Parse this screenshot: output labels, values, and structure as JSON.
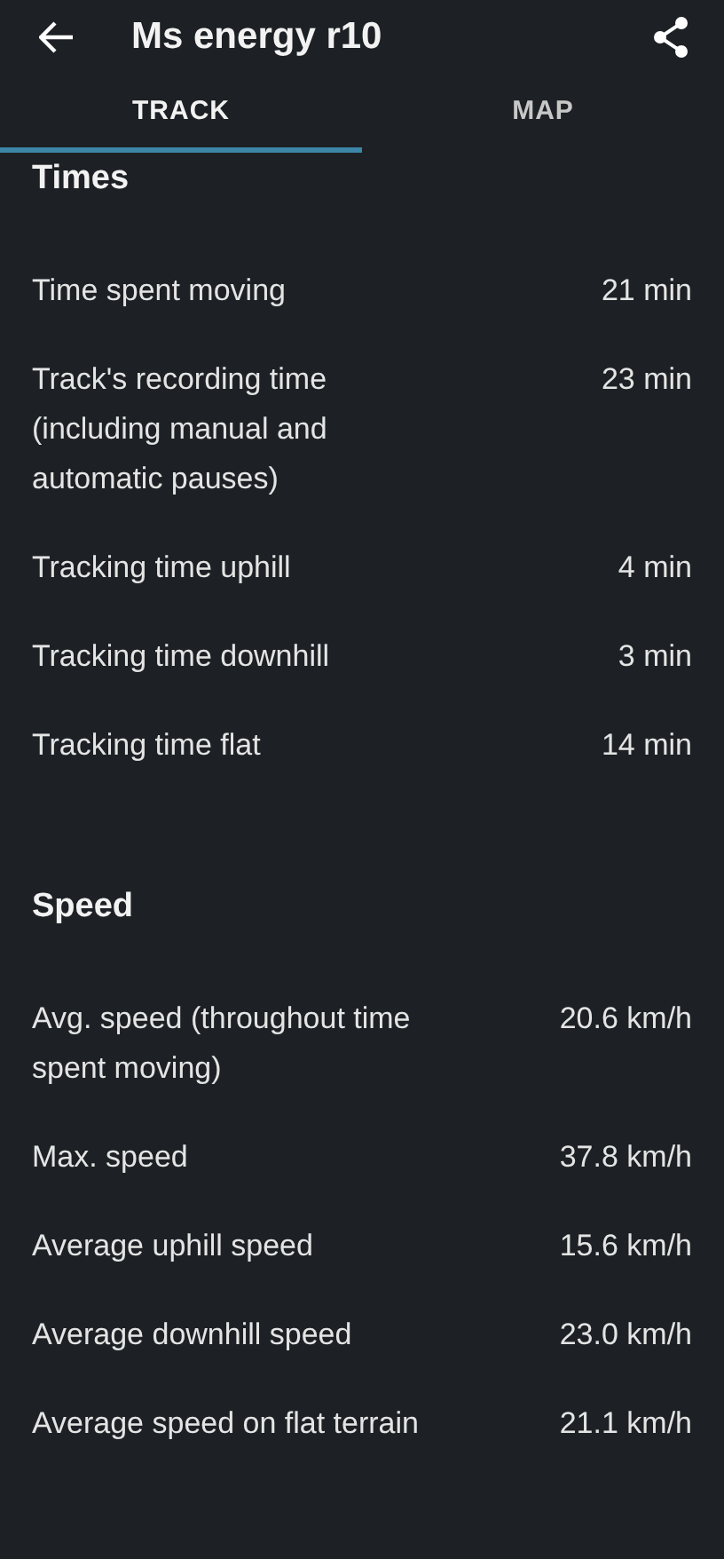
{
  "header": {
    "title": "Ms energy r10"
  },
  "tabs": [
    {
      "label": "TRACK",
      "selected": true
    },
    {
      "label": "MAP",
      "selected": false
    }
  ],
  "sections": [
    {
      "title": "Times",
      "rows": [
        {
          "label": "Time spent moving",
          "value": "21 min"
        },
        {
          "label": "Track's recording time (including manual and automatic pauses)",
          "value": "23 min"
        },
        {
          "label": "Tracking time uphill",
          "value": "4 min"
        },
        {
          "label": "Tracking time downhill",
          "value": "3 min"
        },
        {
          "label": "Tracking time flat",
          "value": "14 min"
        }
      ]
    },
    {
      "title": "Speed",
      "rows": [
        {
          "label": "Avg. speed (throughout time spent moving)",
          "value": "20.6 km/h"
        },
        {
          "label": "Max. speed",
          "value": "37.8 km/h"
        },
        {
          "label": "Average uphill speed",
          "value": "15.6 km/h"
        },
        {
          "label": "Average downhill speed",
          "value": "23.0 km/h"
        },
        {
          "label": "Average speed on flat terrain",
          "value": "21.1 km/h"
        }
      ]
    }
  ]
}
